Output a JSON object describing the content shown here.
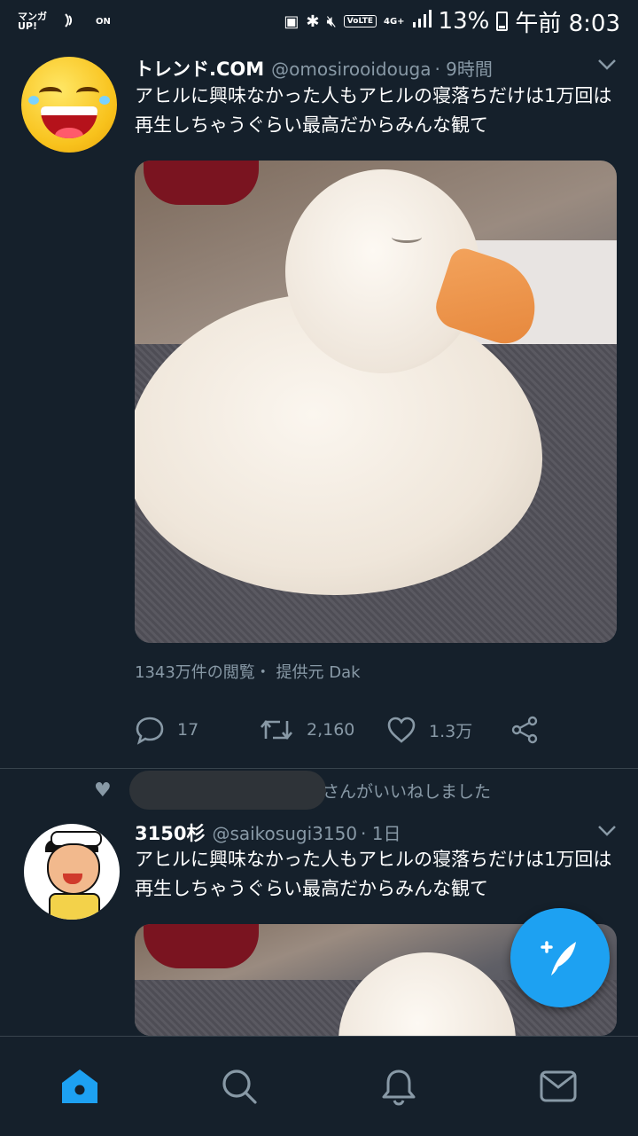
{
  "status_bar": {
    "app_badge": "マンガUP!",
    "nfc_label": "ON",
    "network": "VoLTE",
    "network_type": "4G+",
    "battery": "13%",
    "time": "午前 8:03"
  },
  "tweets": [
    {
      "name": "トレンド.COM",
      "handle": "@omosirooidouga",
      "time": "· 9時間",
      "text": "アヒルに興味なかった人もアヒルの寝落ちだけは1万回は再生しちゃうぐらい最高だからみんな観て",
      "meta": "1343万件の閲覧・ 提供元 Dak",
      "replies": "17",
      "retweets": "2,160",
      "likes": "1.3万"
    },
    {
      "liked_by_suffix": "さんがいいねしました",
      "name": "3150杉",
      "handle": "@saikosugi3150",
      "time": "· 1日",
      "text": "アヒルに興味なかった人もアヒルの寝落ちだけは1万回は再生しちゃうぐらい最高だからみんな観て"
    }
  ],
  "icons": {
    "compose": "compose-feather-icon",
    "home": "home-icon",
    "search": "search-icon",
    "notifications": "bell-icon",
    "messages": "mail-icon"
  },
  "colors": {
    "background": "#15202b",
    "accent": "#1da1f2",
    "secondary_text": "#8899a6",
    "divider": "#38444d"
  }
}
